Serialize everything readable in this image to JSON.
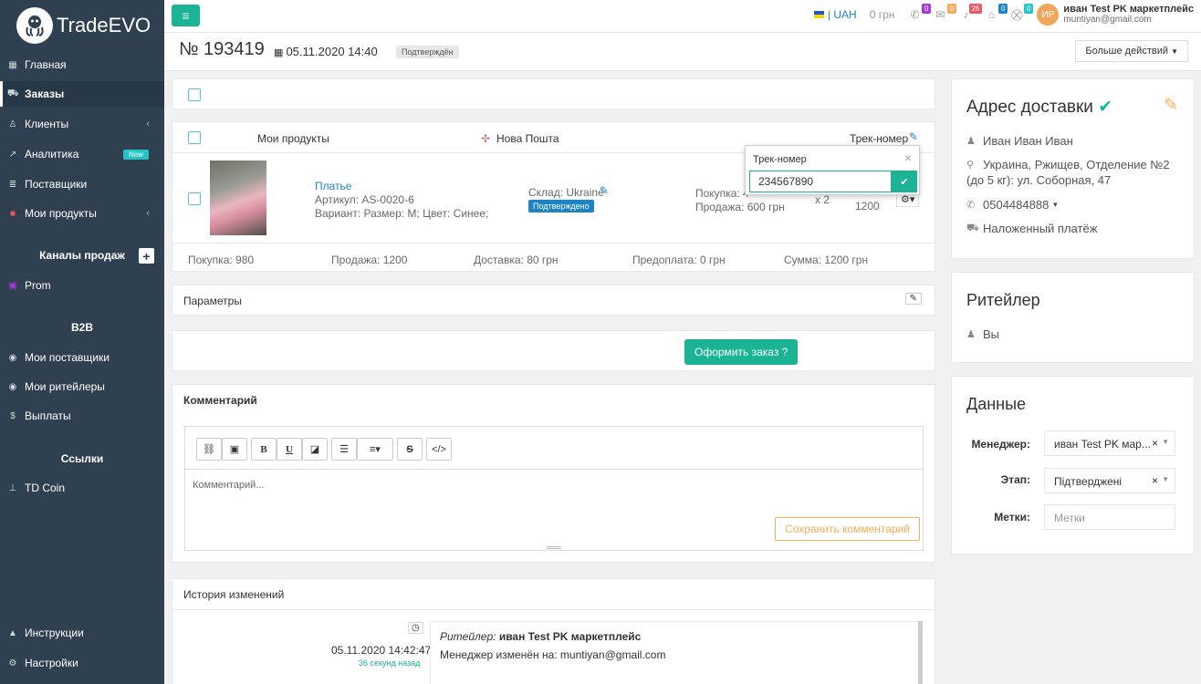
{
  "brand": {
    "name": "TradeEVO"
  },
  "sidebar": {
    "items": [
      {
        "label": "Главная"
      },
      {
        "label": "Заказы"
      },
      {
        "label": "Клиенты"
      },
      {
        "label": "Аналитика",
        "badge": "New"
      },
      {
        "label": "Поставщики"
      },
      {
        "label": "Мои продукты"
      }
    ],
    "sales_channels_title": "Каналы продаж",
    "channels": [
      {
        "label": "Prom"
      }
    ],
    "b2b_title": "B2B",
    "b2b_items": [
      {
        "label": "Мои поставщики"
      },
      {
        "label": "Мои ритейлеры"
      },
      {
        "label": "Выплаты"
      }
    ],
    "links_title": "Ссылки",
    "links": [
      {
        "label": "TD Coin"
      }
    ],
    "bottom": [
      {
        "label": "Инструкции"
      },
      {
        "label": "Настройки"
      }
    ]
  },
  "topbar": {
    "currency": "| UAH",
    "balance": "0 грн",
    "badges": [
      {
        "icon": "phone-icon",
        "count": "0",
        "color": "#a33ad9"
      },
      {
        "icon": "chat-icon",
        "count": "0",
        "color": "#f8ac59"
      },
      {
        "icon": "bell-icon",
        "count": "26",
        "color": "#ed5565"
      },
      {
        "icon": "bank-icon",
        "count": "0",
        "color": "#1c84c6"
      },
      {
        "icon": "cart-icon",
        "count": "0",
        "color": "#23c6c8"
      }
    ],
    "avatar_initials": "ИР",
    "user_name": "иван Test PK маркетплейс",
    "user_email": "muntiyan@gmail.com"
  },
  "header": {
    "order_number": "№ 193419",
    "date": "05.11.2020 14:40",
    "status": "Подтверждён",
    "more_actions": "Больше действий"
  },
  "products": {
    "col_my_products": "Мои продукты",
    "col_delivery": "Нова Пошта",
    "col_track": "Трек-номер",
    "item": {
      "name": "Платье",
      "sku": "Артикул: AS-0020-6",
      "variant": "Вариант: Размер: M; Цвет: Синее;",
      "warehouse": "Склад: Ukraine",
      "warehouse_status": "Подтверждено",
      "purchase": "Покупка: 4",
      "sale": "Продажа: 600 грн",
      "qty": "x 2",
      "total": "1200"
    },
    "summary": {
      "purchase": "Покупка: 980",
      "sale": "Продажа: 1200",
      "delivery": "Доставка: 80 грн",
      "prepay": "Предоплата: 0 грн",
      "sum": "Сумма: 1200 грн"
    }
  },
  "track_popover": {
    "title": "Трек-номер",
    "value": "234567890"
  },
  "params": {
    "title": "Параметры"
  },
  "order_button": "Оформить заказ",
  "comment": {
    "title": "Комментарий",
    "placeholder": "Комментарий...",
    "save": "Сохранить комментарий"
  },
  "history": {
    "title": "История изменений",
    "entries": [
      {
        "date": "05.11.2020 14:42:47",
        "ago": "36 секунд назад",
        "role": "Ритейлер:",
        "actor": "иван Test PK маркетплейс",
        "text": "Менеджер изменён на: muntiyan@gmail.com"
      }
    ]
  },
  "delivery": {
    "title": "Адрес доставки",
    "name": "Иван Иван Иван",
    "address_line1": "Украина, Ржищев, Отделение №2",
    "address_line2": "(до 5 кг): ул. Соборная, 47",
    "phone": "0504484888",
    "payment": "Наложенный платёж"
  },
  "retailer": {
    "title": "Ритейлер",
    "value": "Вы"
  },
  "data_panel": {
    "title": "Данные",
    "manager_label": "Менеджер:",
    "manager_value": "иван Test PK мар...",
    "stage_label": "Этап:",
    "stage_value": "Підтверджені",
    "tags_label": "Метки:",
    "tags_placeholder": "Метки"
  }
}
